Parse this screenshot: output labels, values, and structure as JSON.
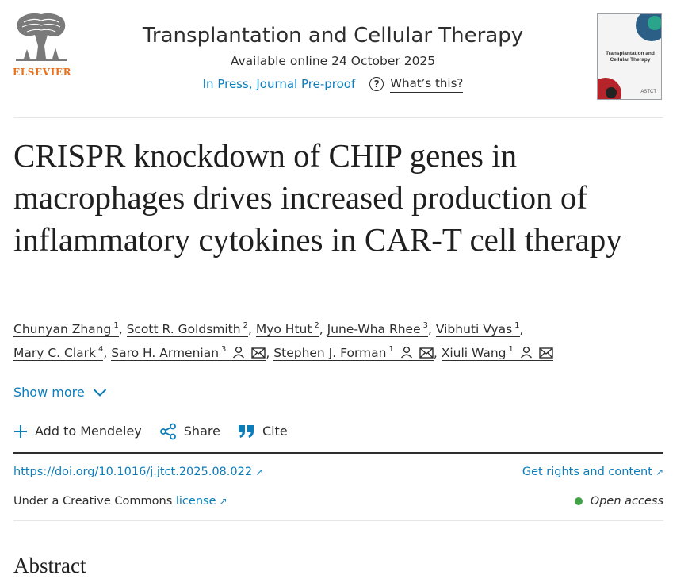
{
  "publisher": {
    "name": "ELSEVIER",
    "logo_icon": "elsevier-tree-logo",
    "brand_color": "#e9711c"
  },
  "journal": {
    "title": "Transplantation and Cellular Therapy",
    "available": "Available online 24 October 2025",
    "status": "In Press, Journal Pre-proof",
    "whats_this": "What’s this?",
    "cover": {
      "title": "Transplantation and Cellular Therapy",
      "brand": "ASTCT"
    }
  },
  "article": {
    "title": "CRISPR knockdown of CHIP genes in macrophages drives increased production of inflammatory cytokines in CAR-T cell therapy",
    "authors": [
      {
        "name": "Chunyan Zhang",
        "sup": "1"
      },
      {
        "name": "Scott R. Goldsmith",
        "sup": "2"
      },
      {
        "name": "Myo Htut",
        "sup": "2"
      },
      {
        "name": "June-Wha Rhee",
        "sup": "3"
      },
      {
        "name": "Vibhuti Vyas",
        "sup": "1"
      },
      {
        "name": "Mary C. Clark",
        "sup": "4"
      },
      {
        "name": "Saro H. Armenian",
        "sup": "3"
      },
      {
        "name": "Stephen J. Forman",
        "sup": "1"
      },
      {
        "name": "Xiuli Wang",
        "sup": "1"
      }
    ],
    "show_more": "Show more",
    "actions": {
      "mendeley": "Add to Mendeley",
      "share": "Share",
      "cite": "Cite"
    },
    "doi": "https://doi.org/10.1016/j.jtct.2025.08.022",
    "rights": "Get rights and content",
    "license_prefix": "Under a Creative Commons",
    "license_link": "license",
    "open_access": "Open access",
    "abstract_heading": "Abstract"
  },
  "colors": {
    "link": "#0c7dbb",
    "text": "#2e2e2e",
    "open_access_dot": "#40a347"
  }
}
